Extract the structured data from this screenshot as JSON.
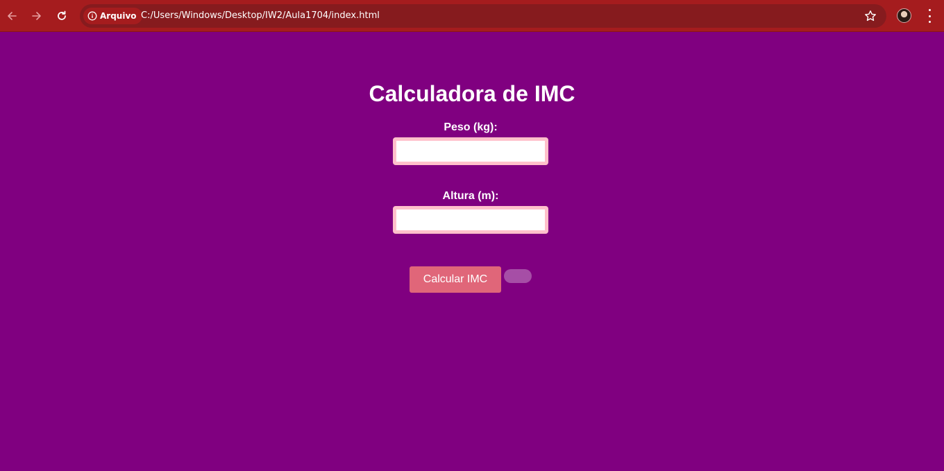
{
  "browser": {
    "back_icon": "arrow-left-icon",
    "forward_icon": "arrow-right-icon",
    "reload_icon": "reload-icon",
    "site_info_label": "Arquivo",
    "url": "C:/Users/Windows/Desktop/IW2/Aula1704/index.html",
    "bookmark_icon": "star-icon",
    "menu_icon": "kebab-menu-icon",
    "toolbar_color": "#a51c1e"
  },
  "page": {
    "title": "Calculadora de IMC",
    "background_color": "#800080",
    "weight_label": "Peso (kg):",
    "weight_value": "",
    "height_label": "Altura (m):",
    "height_value": "",
    "calculate_button": "Calcular IMC",
    "button_color": "#e06679",
    "input_border_color": "#ffc0cb",
    "result_text": ""
  }
}
